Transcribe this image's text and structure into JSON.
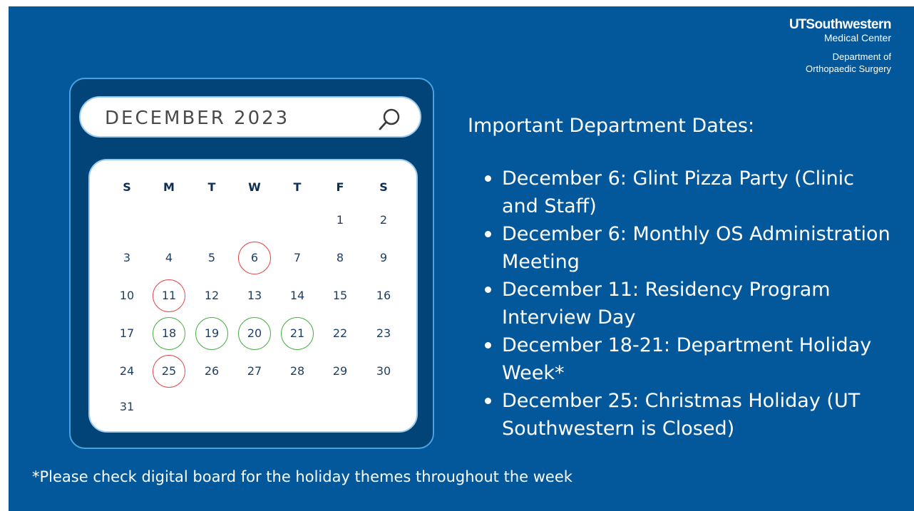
{
  "logo": {
    "brand_ut": "UT",
    "brand_rest": "Southwestern",
    "subtitle": "Medical Center",
    "dept_line1": "Department of",
    "dept_line2": "Orthopaedic Surgery"
  },
  "calendar": {
    "month_label": "DECEMBER 2023",
    "search_icon": "search-icon",
    "weekdays": [
      "S",
      "M",
      "T",
      "W",
      "T",
      "F",
      "S"
    ],
    "weeks": [
      [
        "",
        "",
        "",
        "",
        "",
        "1",
        "2"
      ],
      [
        "3",
        "4",
        "5",
        "6",
        "7",
        "8",
        "9"
      ],
      [
        "10",
        "11",
        "12",
        "13",
        "14",
        "15",
        "16"
      ],
      [
        "17",
        "18",
        "19",
        "20",
        "21",
        "22",
        "23"
      ],
      [
        "24",
        "25",
        "26",
        "27",
        "28",
        "29",
        "30"
      ],
      [
        "31",
        "",
        "",
        "",
        "",
        "",
        ""
      ]
    ],
    "highlighted_red": [
      "6",
      "11",
      "25"
    ],
    "highlighted_green": [
      "18",
      "19",
      "20",
      "21"
    ],
    "colors": {
      "red": "#e4484a",
      "green": "#4db04a",
      "background": "#03589b",
      "frame": "#024478"
    }
  },
  "events": {
    "heading": "Important Department Dates:",
    "items": [
      "December 6: Glint Pizza Party (Clinic and Staff)",
      "December 6: Monthly OS Administration Meeting",
      "December 11: Residency Program Interview Day",
      "December 18-21: Department Holiday Week*",
      "December 25: Christmas Holiday (UT Southwestern is Closed)"
    ]
  },
  "footnote": "*Please check digital board for the holiday themes throughout the week"
}
